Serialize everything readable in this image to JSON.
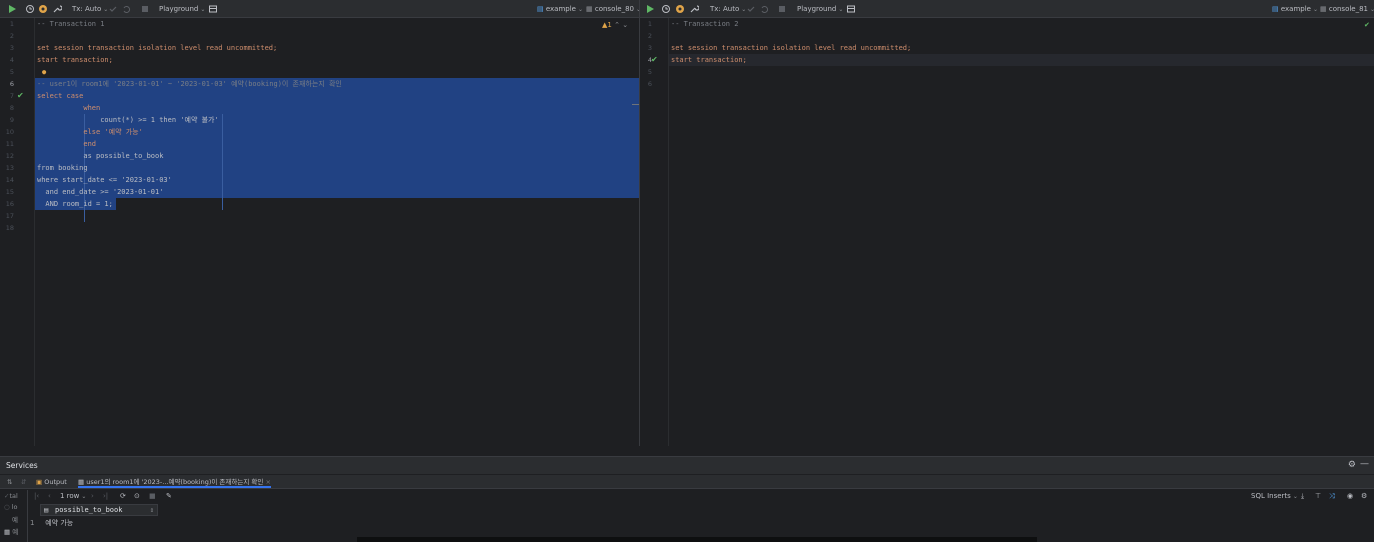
{
  "toolbar_left": {
    "tx_label": "Tx: Auto",
    "playground_label": "Playground",
    "datasource_label": "example",
    "console_label": "console_80"
  },
  "toolbar_right": {
    "tx_label": "Tx: Auto",
    "playground_label": "Playground",
    "datasource_label": "example",
    "console_label": "console_81"
  },
  "editor_left": {
    "inspection_count": "1",
    "line_numbers": [
      "1",
      "2",
      "3",
      "4",
      "5",
      "6",
      "7",
      "8",
      "9",
      "10",
      "11",
      "12",
      "13",
      "14",
      "15",
      "16",
      "17",
      "18"
    ],
    "lines": [
      "-- Transaction 1",
      "",
      "set session transaction isolation level read uncommitted;",
      "start transaction;",
      "",
      "-- user1이 room1에 '2023-01-01' ~ '2023-01-03' 예약(booking)이 존재하는지 확인",
      "select case",
      "           when",
      "               count(*) >= 1 then '예약 불가'",
      "           else '예약 가능'",
      "           end",
      "           as possible_to_book",
      "from booking",
      "where start_date <= '2023-01-03'",
      "  and end_date >= '2023-01-01'",
      "  AND room_id = 1;",
      "",
      ""
    ]
  },
  "editor_right": {
    "line_numbers": [
      "1",
      "2",
      "3",
      "4",
      "5",
      "6"
    ],
    "lines": [
      "-- Transaction 2",
      "",
      "set session transaction isolation level read uncommitted;",
      "start transaction;",
      "",
      ""
    ]
  },
  "services": {
    "title": "Services",
    "tabs": [
      {
        "label": "Output"
      },
      {
        "label": "user1의 room1에 '2023-...예약(booking)이 존재하는지 확인"
      }
    ],
    "row_count_label": "1 row",
    "sql_inserts_label": "SQL Inserts",
    "column_header": "possible_to_book",
    "rows": [
      {
        "index": "1",
        "value": "예약 가능"
      }
    ],
    "left_strip": [
      "tal",
      "lo",
      "예",
      "예"
    ]
  },
  "colors": {
    "background": "#1e1f22",
    "toolbar": "#2b2d30",
    "selection": "#214283",
    "keyword": "#cf8e6d",
    "string": "#6aab73",
    "comment": "#7a7e85",
    "number": "#2aacb8",
    "run": "#5fb865",
    "warning": "#e0a449"
  }
}
